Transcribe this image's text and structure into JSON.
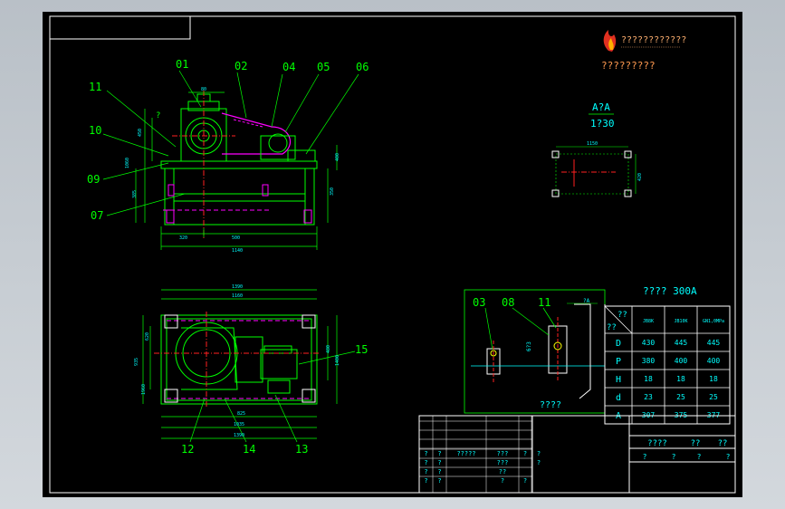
{
  "colors": {
    "background": "#000000",
    "frame": "#ffffff",
    "outline": "#00ff00",
    "dim": "#00ffff",
    "accent": "#ff00ff",
    "text": "#ffffff",
    "logo_text": "#ffb070",
    "centerline": "#ff2020",
    "yellow": "#ffff00"
  },
  "logo": {
    "icon": "flame-logo-icon",
    "line1": "????????????",
    "line2": "?????????"
  },
  "front_view": {
    "leaders": [
      "01",
      "02",
      "04",
      "05",
      "06",
      "11",
      "10",
      "09",
      "07"
    ],
    "dims": {
      "top": "80",
      "left_a": "450",
      "left_b": "1060",
      "left_c": "385",
      "right": "350",
      "bottom_a": "320",
      "bottom_b": "500",
      "bottom_total": "1140",
      "small": "?",
      "right_b": "400"
    }
  },
  "section": {
    "title": "A?A",
    "scale": "1?30",
    "dim_top": "1150",
    "dim_right": "420"
  },
  "plan_view": {
    "leaders": [
      "15",
      "12",
      "14",
      "13"
    ],
    "dims": {
      "top_a": "1390",
      "top_b": "1160",
      "left_a": "620",
      "left_b": "935",
      "left_c": "1960",
      "right_a": "480",
      "right_b": "1400",
      "bottom_a": "825",
      "bottom_b": "1035",
      "bottom_c": "1390"
    }
  },
  "detail": {
    "leaders": [
      "03",
      "08",
      "11"
    ],
    "label": "????",
    "dim_a": "6?3",
    "dim_b": "?A"
  },
  "param_table": {
    "title": "????   300A",
    "header_corner_a": "??",
    "header_corner_b": "??",
    "columns": [
      "JB8K",
      "JB10K",
      "GN1,0MPa"
    ],
    "rows": [
      {
        "key": "D",
        "values": [
          "430",
          "445",
          "445"
        ]
      },
      {
        "key": "P",
        "values": [
          "380",
          "400",
          "400"
        ]
      },
      {
        "key": "H",
        "values": [
          "18",
          "18",
          "18"
        ]
      },
      {
        "key": "d",
        "values": [
          "23",
          "25",
          "25"
        ]
      },
      {
        "key": "A",
        "values": [
          "307",
          "375",
          "377"
        ]
      }
    ]
  },
  "title_block": {
    "left_rows": [
      [
        "?",
        "?",
        "?????",
        "???",
        "?",
        "?"
      ],
      [
        "?",
        "?",
        "",
        "???",
        "",
        "?"
      ],
      [
        "?",
        "?",
        "",
        "??",
        "",
        ""
      ],
      [
        "?",
        "?",
        "",
        "?",
        "?",
        ""
      ]
    ],
    "right_top": [
      "????",
      "??",
      "??"
    ],
    "right_mid": [
      "?",
      "?",
      "?",
      "?"
    ]
  }
}
